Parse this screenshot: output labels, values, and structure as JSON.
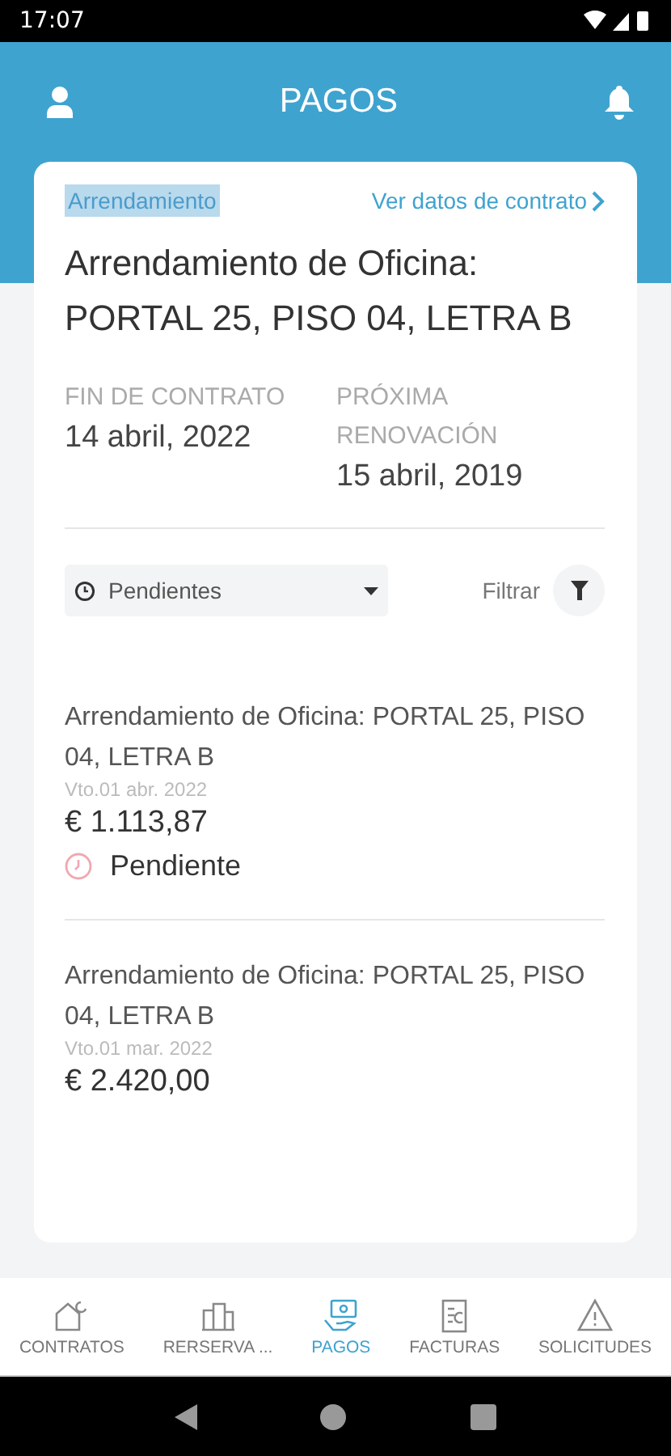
{
  "status_bar": {
    "time": "17:07"
  },
  "header": {
    "title": "PAGOS"
  },
  "contract": {
    "tag": "Arrendamiento",
    "link": "Ver datos de contrato",
    "title": "Arrendamiento de Oficina: PORTAL 25, PISO 04, LETRA B",
    "fields": [
      {
        "label": "FIN DE CONTRATO",
        "value": "14 abril, 2022"
      },
      {
        "label": "PRÓXIMA RENOVACIÓN",
        "value": "15 abril, 2019"
      }
    ]
  },
  "filter": {
    "dropdown": "Pendientes",
    "button": "Filtrar"
  },
  "payments": [
    {
      "title": "Arrendamiento de Oficina: PORTAL 25, PISO 04, LETRA B",
      "due": "Vto.01 abr. 2022",
      "amount": "€ 1.113,87",
      "status": "Pendiente"
    },
    {
      "title": "Arrendamiento de Oficina: PORTAL 25, PISO 04, LETRA B",
      "due": "Vto.01 mar. 2022",
      "amount": "€ 2.420,00"
    }
  ],
  "bottom_nav": [
    {
      "label": "CONTRATOS",
      "kind": "house",
      "selected": false
    },
    {
      "label": "RERSERVA ...",
      "kind": "building",
      "selected": false
    },
    {
      "label": "PAGOS",
      "kind": "payment",
      "selected": true
    },
    {
      "label": "FACTURAS",
      "kind": "invoice",
      "selected": false
    },
    {
      "label": "SOLICITUDES",
      "kind": "warning",
      "selected": false
    }
  ]
}
